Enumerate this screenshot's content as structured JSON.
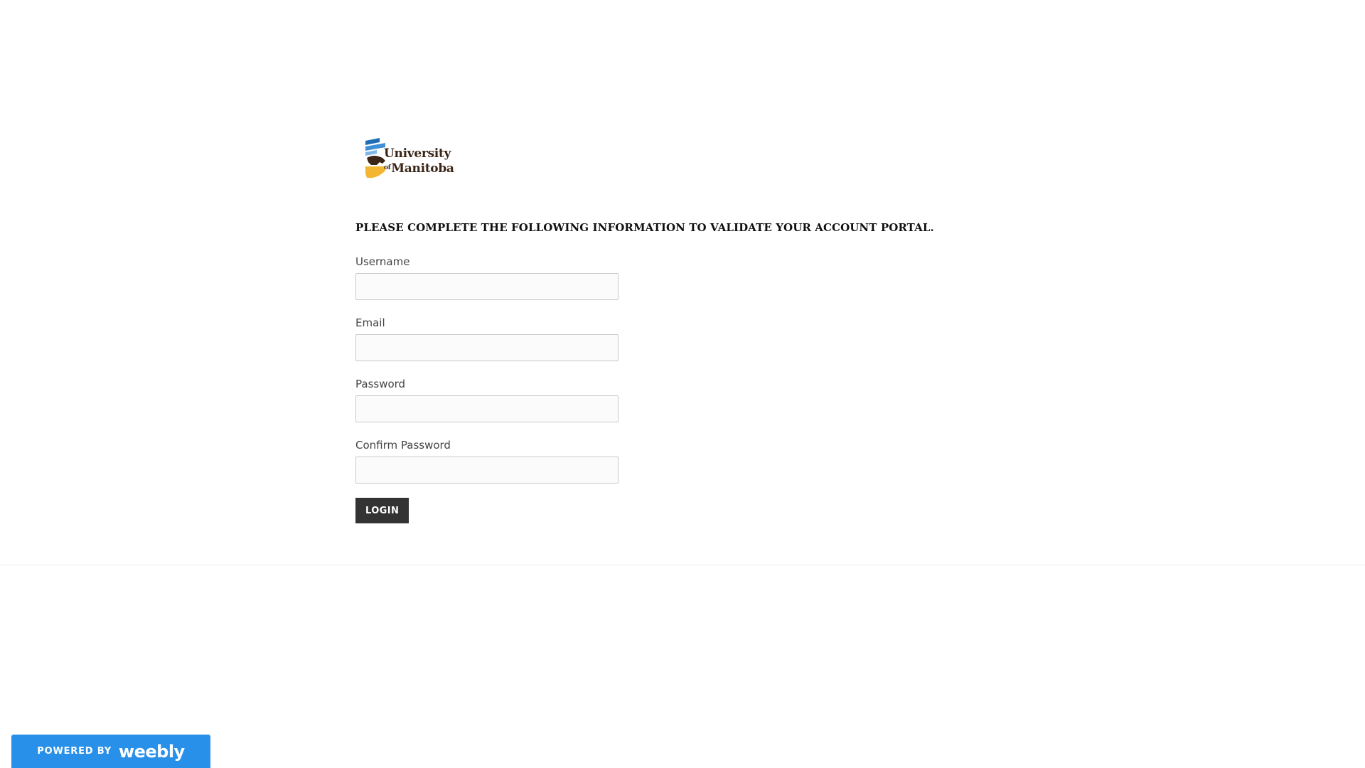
{
  "logo": {
    "line1": "University",
    "of": "of",
    "line2": "Manitoba",
    "icon": "university-crest-icon"
  },
  "form": {
    "heading": "PLEASE COMPLETE THE FOLLOWING INFORMATION TO VALIDATE YOUR ACCOUNT PORTAL.",
    "fields": [
      {
        "label": "Username",
        "value": ""
      },
      {
        "label": "Email",
        "value": ""
      },
      {
        "label": "Password",
        "value": ""
      },
      {
        "label": "Confirm Password",
        "value": ""
      }
    ],
    "submit_label": "LOGIN"
  },
  "footer": {
    "badge_text": "POWERED BY",
    "badge_brand": "weebly"
  },
  "colors": {
    "button_bg": "#333333",
    "badge_bg": "#2990ea",
    "logo_blue": "#1f6db5",
    "logo_gold": "#f2b632",
    "logo_brown": "#3a2516"
  }
}
